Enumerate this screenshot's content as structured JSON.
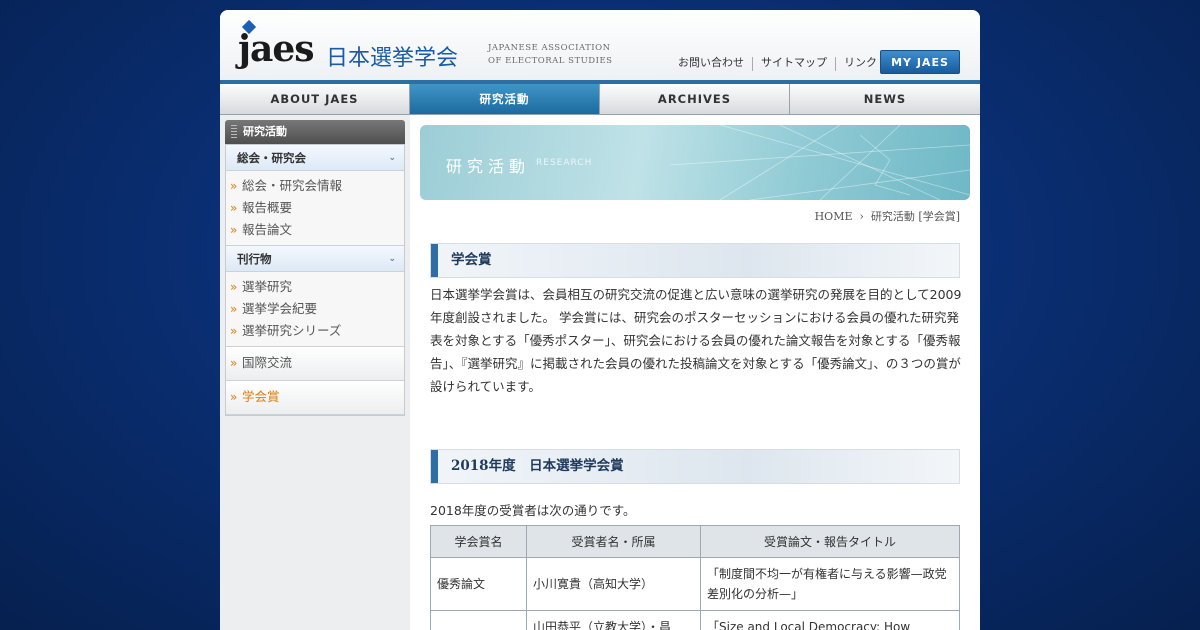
{
  "header": {
    "logo_mark": "jaes",
    "logo_jp": "日本選挙学会",
    "logo_en": "JAPANESE ASSOCIATION OF ELECTORAL STUDIES",
    "util_links": [
      "お問い合わせ",
      "サイトマップ",
      "リンク"
    ],
    "myjaes_label": "MY JAES"
  },
  "nav": {
    "tabs": [
      {
        "label": "ABOUT JAES",
        "active": false
      },
      {
        "label": "研究活動",
        "active": true
      },
      {
        "label": "ARCHIVES",
        "active": false
      },
      {
        "label": "NEWS",
        "active": false
      }
    ]
  },
  "sidebar": {
    "header": "研究活動",
    "categories": [
      {
        "label": "総会・研究会",
        "items": [
          "総会・研究会情報",
          "報告概要",
          "報告論文"
        ]
      },
      {
        "label": "刊行物",
        "items": [
          "選挙研究",
          "選挙学会紀要",
          "選挙研究シリーズ"
        ]
      }
    ],
    "singles": [
      {
        "label": "国際交流",
        "active": false
      },
      {
        "label": "学会賞",
        "active": true
      }
    ]
  },
  "main": {
    "banner_title": "研究活動",
    "banner_sub": "RESEARCH",
    "breadcrumb_home": "HOME",
    "breadcrumb_current": "研究活動 [学会賞]",
    "section1_title": "学会賞",
    "intro": "日本選挙学会賞は、会員相互の研究交流の促進と広い意味の選挙研究の発展を目的として2009年度創設されました。 学会賞には、研究会のポスターセッションにおける会員の優れた研究発表を対象とする「優秀ポスター」、研究会における会員の優れた論文報告を対象とする「優秀報告」、『選挙研究』に掲載された会員の優れた投稿論文を対象とする「優秀論文」、の３つの賞が設けられています。",
    "section2_title": "2018年度　日本選挙学会賞",
    "year_text": "2018年度の受賞者は次の通りです。",
    "table": {
      "headers": [
        "学会賞名",
        "受賞者名・所属",
        "受賞論文・報告タイトル"
      ],
      "rows": [
        [
          "優秀論文",
          "小川寛貴（高知大学）",
          "「制度間不均一が有権者に与える影響—政党差別化の分析—」"
        ],
        [
          "",
          "山田恭平（立教大学）・昌",
          "「Size and Local Democracy: How"
        ]
      ]
    }
  }
}
